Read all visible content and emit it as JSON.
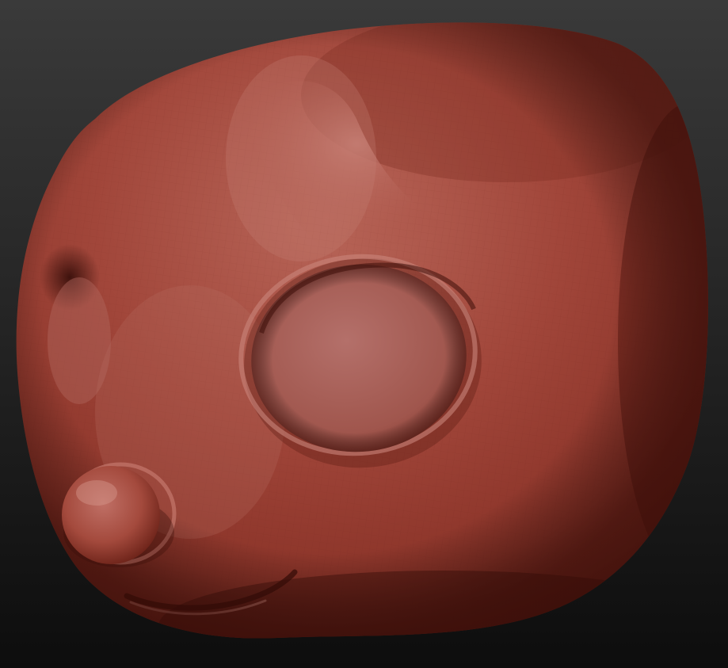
{
  "scene": {
    "subject": "sculpted-head",
    "material_color": "#9a3f33",
    "highlight_color": "#c27a70",
    "shadow_color": "#4a1510",
    "background_top_color": "#3a3a3a",
    "background_bottom_color": "#0d0d0d"
  }
}
